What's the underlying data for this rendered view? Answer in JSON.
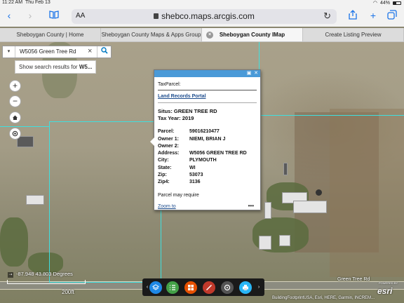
{
  "status": {
    "time": "11:22 AM",
    "date": "Thu Feb 13",
    "battery": "44%",
    "battery_level": 0.44
  },
  "browser": {
    "text_size_label": "AA",
    "url": "shebco.maps.arcgis.com",
    "tabs": [
      {
        "label": "Sheboygan County | Home"
      },
      {
        "label": "Sheboygan County Maps & Apps Group"
      },
      {
        "label": "Sheboygan County IMap",
        "active": true
      },
      {
        "label": "Create Listing Preview"
      }
    ]
  },
  "search": {
    "value": "W5056 Green Tree Rd",
    "suggestion_prefix": "Show search results for ",
    "suggestion_term": "W5..."
  },
  "map_controls": {
    "zoom_in": "+",
    "zoom_out": "−"
  },
  "popup": {
    "title": "TaxParcel:",
    "link": "Land Records Portal",
    "situs": "Situs:  GREEN TREE RD",
    "tax_year": "Tax Year: 2019",
    "fields": [
      {
        "key": "Parcel:",
        "value": "59016210477"
      },
      {
        "key": "Owner 1:",
        "value": "NIEMI, BRIAN J"
      },
      {
        "key": "Owner 2:",
        "value": ""
      },
      {
        "key": "Address:",
        "value": "W5056 GREEN TREE RD"
      },
      {
        "key": "City:",
        "value": "PLYMOUTH"
      },
      {
        "key": "State:",
        "value": "WI"
      },
      {
        "key": "Zip:",
        "value": "53073"
      },
      {
        "key": "Zip4:",
        "value": "3136"
      }
    ],
    "note": "Parcel may require",
    "zoom_to": "Zoom to",
    "more": "•••"
  },
  "map": {
    "coordinates": "-87.948 43.803 Degrees",
    "scale_label": "200ft",
    "road_label": "Green Tree Rd",
    "attribution": "BuildingFootprintUSA, Esri, HERE, Garmin, INCREM...",
    "esri_powered": "POWERED BY",
    "esri_logo": "esri",
    "parcel_color": "#3ee0e0"
  },
  "bottom_toolbar": {
    "prev": "‹",
    "next": "›",
    "buttons": [
      {
        "icon": "layers-icon",
        "color": "#1e88e5"
      },
      {
        "icon": "legend-icon",
        "color": "#43a047"
      },
      {
        "icon": "basemap-icon",
        "color": "#e65100"
      },
      {
        "icon": "measure-icon",
        "color": "#c0392b"
      },
      {
        "icon": "print-settings-icon",
        "color": "#555555"
      },
      {
        "icon": "print-icon",
        "color": "#29b6f6"
      }
    ]
  }
}
